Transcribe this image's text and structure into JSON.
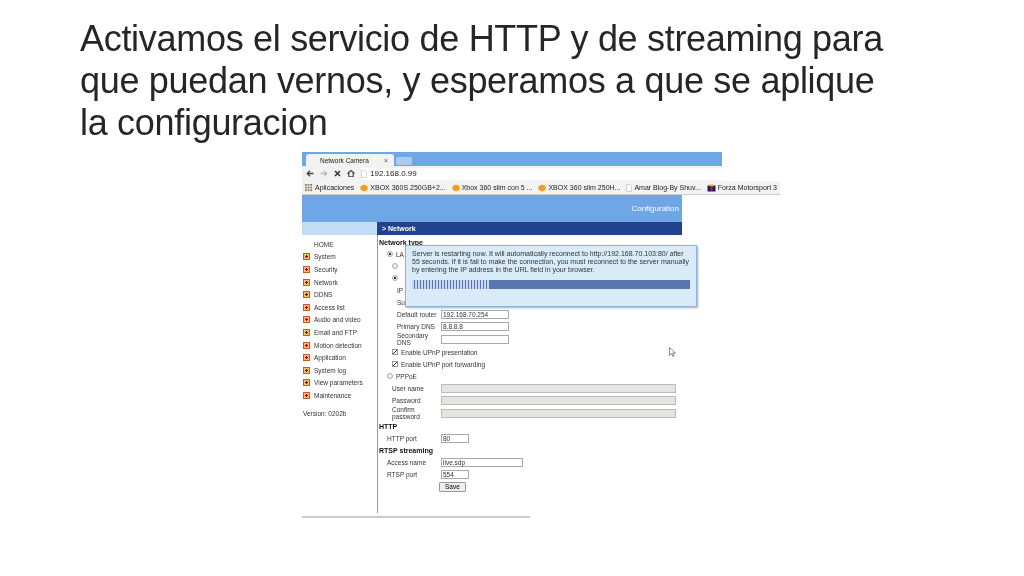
{
  "slide_title": "Activamos el servicio de HTTP y de streaming para que puedan vernos, y esperamos a que se aplique la configuracion",
  "browser": {
    "tabs": [
      {
        "label": "Network Camera",
        "close": "×",
        "selected": true
      }
    ],
    "address": "192.168.0.99",
    "bookmarks": [
      {
        "kind": "apps",
        "label": "Aplicaciones"
      },
      {
        "kind": "box",
        "label": "XBOX 360S 250GB+2..."
      },
      {
        "kind": "box",
        "label": "Xbox 360 slim con 5 ..."
      },
      {
        "kind": "box",
        "label": "XBOX 360 slim 250H..."
      },
      {
        "kind": "page",
        "label": "Amar Blog-By Shuv..."
      },
      {
        "kind": "game",
        "label": "Forza Motorsport 3"
      }
    ]
  },
  "page": {
    "header": "Configuration",
    "sidebar": [
      {
        "label": "HOME",
        "expandable": false
      },
      {
        "label": "System",
        "expandable": true
      },
      {
        "label": "Security",
        "expandable": true
      },
      {
        "label": "Network",
        "expandable": true
      },
      {
        "label": "DDNS",
        "expandable": true
      },
      {
        "label": "Access list",
        "expandable": true
      },
      {
        "label": "Audio and video",
        "expandable": true
      },
      {
        "label": "Email and FTP",
        "expandable": true
      },
      {
        "label": "Motion detection",
        "expandable": true
      },
      {
        "label": "Application",
        "expandable": true
      },
      {
        "label": "System log",
        "expandable": true
      },
      {
        "label": "View parameters",
        "expandable": true
      },
      {
        "label": "Maintenance",
        "expandable": true
      }
    ],
    "version": "Version: 0202b",
    "section_bar": "> Network",
    "form": [
      {
        "kind": "heading",
        "label": "Network type"
      },
      {
        "kind": "radio",
        "label": "LA",
        "selected": true,
        "children": [
          {
            "kind": "radio",
            "selected": false
          },
          {
            "kind": "radio",
            "selected": true,
            "children": [
              {
                "kind": "stub",
                "label": "IP"
              },
              {
                "kind": "stub",
                "label": "Su"
              },
              {
                "kind": "field",
                "label": "Default router",
                "value": "192.168.70.254"
              },
              {
                "kind": "field",
                "label": "Primary DNS",
                "value": "8.8.8.8"
              },
              {
                "kind": "field",
                "label": "Secondary DNS"
              }
            ]
          },
          {
            "kind": "checkbox",
            "label": "Enable UPnP presentation",
            "checked": true
          },
          {
            "kind": "checkbox",
            "label": "Enable UPnP port forwarding",
            "checked": true
          }
        ]
      },
      {
        "kind": "radio",
        "label": "PPPoE",
        "selected": false,
        "children": [
          {
            "kind": "longfield",
            "label": "User name",
            "disabled": true
          },
          {
            "kind": "longfield",
            "label": "Password",
            "disabled": true
          },
          {
            "kind": "longfield",
            "label": "Confirm password",
            "disabled": true
          }
        ]
      },
      {
        "kind": "section",
        "label": "HTTP"
      },
      {
        "kind": "shortfield",
        "label": "HTTP port",
        "value": "80"
      },
      {
        "kind": "section",
        "label": "RTSP streaming"
      },
      {
        "kind": "widefield",
        "label": "Access name",
        "value": "live.sdp"
      },
      {
        "kind": "shortfield",
        "label": "RTSP port",
        "value": "554"
      },
      {
        "kind": "button",
        "label": "Save"
      }
    ],
    "dialog": {
      "message": "Server is restarting now. It will automatically reconnect to http://192.168.70.103:80/ after 55 seconds. If it is fail to make the connection, you must reconnect to the server manually by entering the IP address in the URL field in your browser.",
      "level": 0.28
    }
  }
}
